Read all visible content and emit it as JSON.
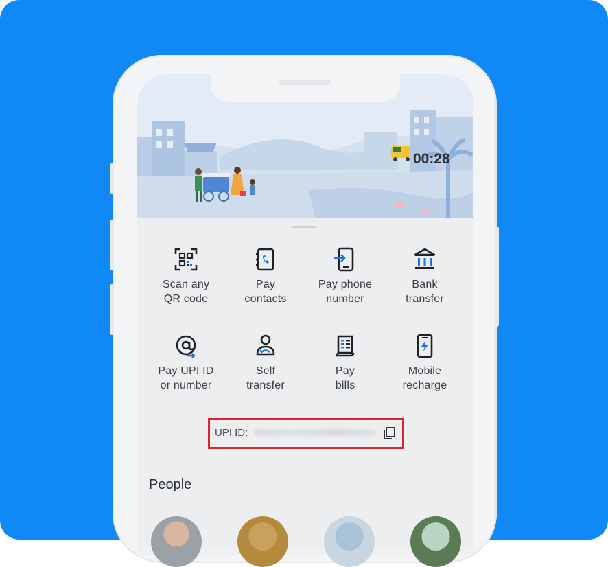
{
  "status": {
    "time": "00:28"
  },
  "actions": [
    {
      "icon": "qr-scan-icon",
      "label": "Scan any\nQR code"
    },
    {
      "icon": "contacts-book-icon",
      "label": "Pay\ncontacts"
    },
    {
      "icon": "phone-arrow-icon",
      "label": "Pay phone\nnumber"
    },
    {
      "icon": "bank-icon",
      "label": "Bank\ntransfer"
    },
    {
      "icon": "at-sign-icon",
      "label": "Pay UPI ID\nor number"
    },
    {
      "icon": "self-transfer-icon",
      "label": "Self\ntransfer"
    },
    {
      "icon": "bill-receipt-icon",
      "label": "Pay\nbills"
    },
    {
      "icon": "mobile-recharge-icon",
      "label": "Mobile\nrecharge"
    }
  ],
  "upi": {
    "label": "UPI ID:",
    "copy_icon": "copy-icon"
  },
  "people": {
    "title": "People"
  },
  "colors": {
    "background": "#1089f6",
    "highlight": "#e21f33",
    "accent": "#1a73e8"
  }
}
